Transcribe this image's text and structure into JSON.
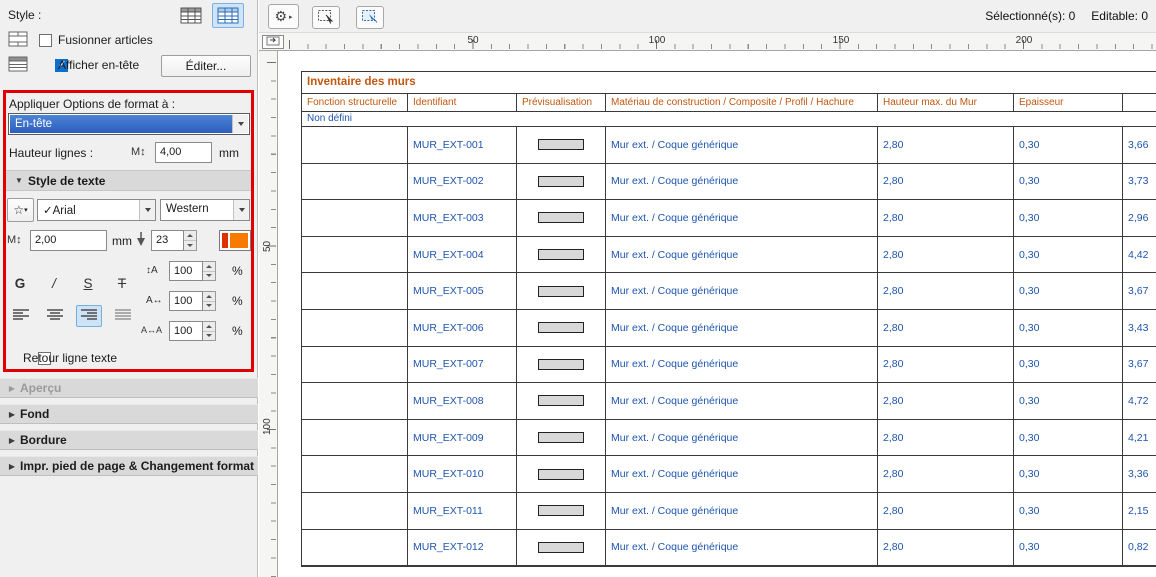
{
  "colors": {
    "accent_blue": "#2c5fbe",
    "table_text_blue": "#1d54ae",
    "header_orange": "#c2570f",
    "annotation_red": "#e10000",
    "pen_swatch_orange": "#f87a00"
  },
  "icons": {
    "collapse_panel": "◀",
    "section_collapsed": "▶",
    "section_expanded": "▼",
    "gear": "⚙",
    "gear_more": "▸",
    "star": "☆",
    "star_more": "▾",
    "check": "✓",
    "text_height": "M↕",
    "line_spacing": "↕A",
    "width_factor": "A↔",
    "char_spacing": "A↔A",
    "bold": "G",
    "italic": "/",
    "underline": "S",
    "strike": "T"
  },
  "topbar": {
    "selected_count": "Sélectionné(s): 0",
    "editable_count": "Editable: 0"
  },
  "panel": {
    "style_label": "Style :",
    "merge_label": "Fusionner articles",
    "show_header_label": "Afficher en-tête",
    "edit_button": "Éditer...",
    "apply_label": "Appliquer Options de format à :",
    "apply_value": "En-tête",
    "row_height_label": "Hauteur lignes :",
    "row_height_value": "4,00",
    "row_height_unit": "mm",
    "text_style": {
      "section_label": "Style de texte",
      "font_value": "Arial",
      "encoding_value": "Western",
      "size_value": "2,00",
      "size_unit": "mm",
      "pen_value": "23",
      "line_spacing_value": "100",
      "width_factor_value": "100",
      "char_spacing_value": "100",
      "percent": "%"
    },
    "wrap_label": "Retour ligne texte",
    "sections": [
      {
        "label": "Aperçu",
        "disabled": true
      },
      {
        "label": "Fond",
        "disabled": false
      },
      {
        "label": "Bordure",
        "disabled": false
      },
      {
        "label": "Impr. pied de page & Changement format",
        "disabled": false
      }
    ]
  },
  "ruler": {
    "horizontal": [
      "50",
      "100",
      "150",
      "200"
    ],
    "vertical": [
      "50",
      "100"
    ]
  },
  "table": {
    "title": "Inventaire des murs",
    "columns": [
      "Fonction structurelle",
      "Identifiant",
      "Prévisualisation",
      "Matériau de construction / Composite / Profil / Hachure",
      "Hauteur max. du Mur",
      "Epaisseur"
    ],
    "group_label": "Non défini",
    "rows": [
      {
        "id": "MUR_EXT-001",
        "material": "Mur ext. / Coque générique",
        "max_height": "2,80",
        "thickness": "0,30",
        "value": "3,66"
      },
      {
        "id": "MUR_EXT-002",
        "material": "Mur ext. / Coque générique",
        "max_height": "2,80",
        "thickness": "0,30",
        "value": "3,73"
      },
      {
        "id": "MUR_EXT-003",
        "material": "Mur ext. / Coque générique",
        "max_height": "2,80",
        "thickness": "0,30",
        "value": "2,96"
      },
      {
        "id": "MUR_EXT-004",
        "material": "Mur ext. / Coque générique",
        "max_height": "2,80",
        "thickness": "0,30",
        "value": "4,42"
      },
      {
        "id": "MUR_EXT-005",
        "material": "Mur ext. / Coque générique",
        "max_height": "2,80",
        "thickness": "0,30",
        "value": "3,67"
      },
      {
        "id": "MUR_EXT-006",
        "material": "Mur ext. / Coque générique",
        "max_height": "2,80",
        "thickness": "0,30",
        "value": "3,43"
      },
      {
        "id": "MUR_EXT-007",
        "material": "Mur ext. / Coque générique",
        "max_height": "2,80",
        "thickness": "0,30",
        "value": "3,67"
      },
      {
        "id": "MUR_EXT-008",
        "material": "Mur ext. / Coque générique",
        "max_height": "2,80",
        "thickness": "0,30",
        "value": "4,72"
      },
      {
        "id": "MUR_EXT-009",
        "material": "Mur ext. / Coque générique",
        "max_height": "2,80",
        "thickness": "0,30",
        "value": "4,21"
      },
      {
        "id": "MUR_EXT-010",
        "material": "Mur ext. / Coque générique",
        "max_height": "2,80",
        "thickness": "0,30",
        "value": "3,36"
      },
      {
        "id": "MUR_EXT-011",
        "material": "Mur ext. / Coque générique",
        "max_height": "2,80",
        "thickness": "0,30",
        "value": "2,15"
      },
      {
        "id": "MUR_EXT-012",
        "material": "Mur ext. / Coque générique",
        "max_height": "2,80",
        "thickness": "0,30",
        "value": "0,82"
      }
    ]
  }
}
